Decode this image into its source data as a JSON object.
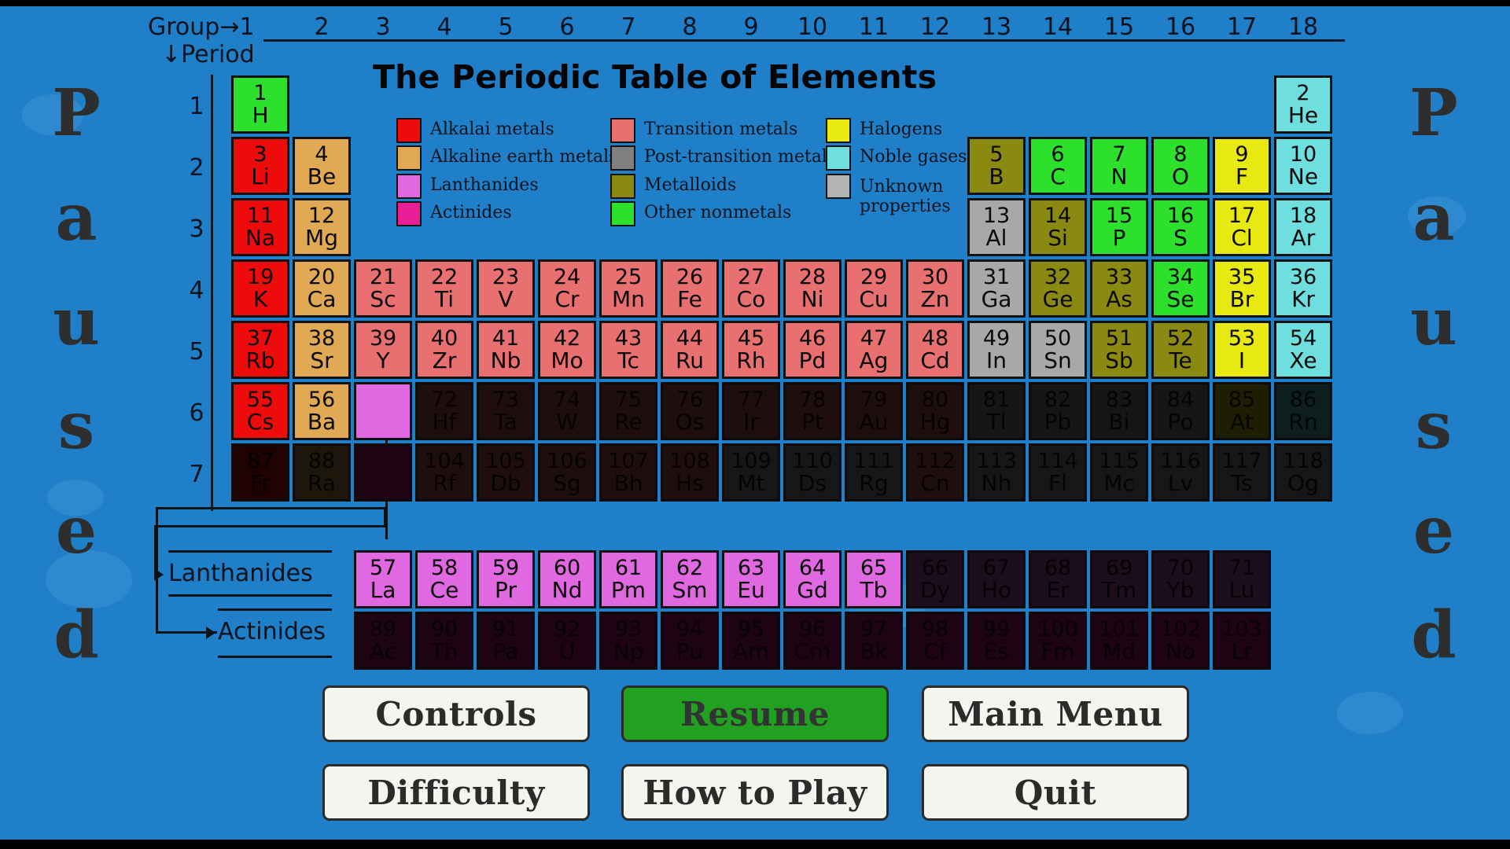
{
  "screen": {
    "background_color": "#1f7fc9",
    "paused_text": "Paused",
    "title": "The Periodic Table of Elements",
    "group_label": "Group→1",
    "period_label": "↓Period",
    "group_numbers": [
      "2",
      "3",
      "4",
      "5",
      "6",
      "7",
      "8",
      "9",
      "10",
      "11",
      "12",
      "13",
      "14",
      "15",
      "16",
      "17",
      "18"
    ],
    "period_numbers": [
      "1",
      "2",
      "3",
      "4",
      "5",
      "6",
      "7"
    ],
    "lanthanides_label": "Lanthanides",
    "actinides_label": "Actinides"
  },
  "legend": {
    "items": [
      {
        "label": "Alkalai metals",
        "color": "#ee0b0b"
      },
      {
        "label": "Alkaline earth metals",
        "color": "#e2a955"
      },
      {
        "label": "Lanthanides",
        "color": "#e068e0"
      },
      {
        "label": "Actinides",
        "color": "#e81e96"
      },
      {
        "label": "Transition metals",
        "color": "#e97070"
      },
      {
        "label": "Post-transition metals",
        "color": "#7f7f7f"
      },
      {
        "label": "Metalloids",
        "color": "#8a8a12"
      },
      {
        "label": "Other nonmetals",
        "color": "#2ce02c"
      },
      {
        "label": "Halogens",
        "color": "#e8e812"
      },
      {
        "label": "Noble gases",
        "color": "#6fdede"
      },
      {
        "label": "Unknown properties",
        "color": "#b3b3b3"
      }
    ]
  },
  "buttons": [
    {
      "label": "Controls",
      "style": "light"
    },
    {
      "label": "Resume",
      "style": "green"
    },
    {
      "label": "Main Menu",
      "style": "light"
    },
    {
      "label": "Difficulty",
      "style": "light"
    },
    {
      "label": "How to Play",
      "style": "light"
    },
    {
      "label": "Quit",
      "style": "light"
    }
  ],
  "elements": [
    {
      "n": 1,
      "s": "H",
      "g": 1,
      "p": 1,
      "c": "#2ce02c",
      "dim": false
    },
    {
      "n": 2,
      "s": "He",
      "g": 18,
      "p": 1,
      "c": "#6fdede",
      "dim": false
    },
    {
      "n": 3,
      "s": "Li",
      "g": 1,
      "p": 2,
      "c": "#ee0b0b",
      "dim": false
    },
    {
      "n": 4,
      "s": "Be",
      "g": 2,
      "p": 2,
      "c": "#e2a955",
      "dim": false
    },
    {
      "n": 5,
      "s": "B",
      "g": 13,
      "p": 2,
      "c": "#8a8a12",
      "dim": false
    },
    {
      "n": 6,
      "s": "C",
      "g": 14,
      "p": 2,
      "c": "#2ce02c",
      "dim": false
    },
    {
      "n": 7,
      "s": "N",
      "g": 15,
      "p": 2,
      "c": "#2ce02c",
      "dim": false
    },
    {
      "n": 8,
      "s": "O",
      "g": 16,
      "p": 2,
      "c": "#2ce02c",
      "dim": false
    },
    {
      "n": 9,
      "s": "F",
      "g": 17,
      "p": 2,
      "c": "#e8e812",
      "dim": false
    },
    {
      "n": 10,
      "s": "Ne",
      "g": 18,
      "p": 2,
      "c": "#6fdede",
      "dim": false
    },
    {
      "n": 11,
      "s": "Na",
      "g": 1,
      "p": 3,
      "c": "#ee0b0b",
      "dim": false
    },
    {
      "n": 12,
      "s": "Mg",
      "g": 2,
      "p": 3,
      "c": "#e2a955",
      "dim": false
    },
    {
      "n": 13,
      "s": "Al",
      "g": 13,
      "p": 3,
      "c": "#a8a8a8",
      "dim": false
    },
    {
      "n": 14,
      "s": "Si",
      "g": 14,
      "p": 3,
      "c": "#8a8a12",
      "dim": false
    },
    {
      "n": 15,
      "s": "P",
      "g": 15,
      "p": 3,
      "c": "#2ce02c",
      "dim": false
    },
    {
      "n": 16,
      "s": "S",
      "g": 16,
      "p": 3,
      "c": "#2ce02c",
      "dim": false
    },
    {
      "n": 17,
      "s": "Cl",
      "g": 17,
      "p": 3,
      "c": "#e8e812",
      "dim": false
    },
    {
      "n": 18,
      "s": "Ar",
      "g": 18,
      "p": 3,
      "c": "#6fdede",
      "dim": false
    },
    {
      "n": 19,
      "s": "K",
      "g": 1,
      "p": 4,
      "c": "#ee0b0b",
      "dim": false
    },
    {
      "n": 20,
      "s": "Ca",
      "g": 2,
      "p": 4,
      "c": "#e2a955",
      "dim": false
    },
    {
      "n": 21,
      "s": "Sc",
      "g": 3,
      "p": 4,
      "c": "#e97070",
      "dim": false
    },
    {
      "n": 22,
      "s": "Ti",
      "g": 4,
      "p": 4,
      "c": "#e97070",
      "dim": false
    },
    {
      "n": 23,
      "s": "V",
      "g": 5,
      "p": 4,
      "c": "#e97070",
      "dim": false
    },
    {
      "n": 24,
      "s": "Cr",
      "g": 6,
      "p": 4,
      "c": "#e97070",
      "dim": false
    },
    {
      "n": 25,
      "s": "Mn",
      "g": 7,
      "p": 4,
      "c": "#e97070",
      "dim": false
    },
    {
      "n": 26,
      "s": "Fe",
      "g": 8,
      "p": 4,
      "c": "#e97070",
      "dim": false
    },
    {
      "n": 27,
      "s": "Co",
      "g": 9,
      "p": 4,
      "c": "#e97070",
      "dim": false
    },
    {
      "n": 28,
      "s": "Ni",
      "g": 10,
      "p": 4,
      "c": "#e97070",
      "dim": false
    },
    {
      "n": 29,
      "s": "Cu",
      "g": 11,
      "p": 4,
      "c": "#e97070",
      "dim": false
    },
    {
      "n": 30,
      "s": "Zn",
      "g": 12,
      "p": 4,
      "c": "#e97070",
      "dim": false
    },
    {
      "n": 31,
      "s": "Ga",
      "g": 13,
      "p": 4,
      "c": "#a8a8a8",
      "dim": false
    },
    {
      "n": 32,
      "s": "Ge",
      "g": 14,
      "p": 4,
      "c": "#8a8a12",
      "dim": false
    },
    {
      "n": 33,
      "s": "As",
      "g": 15,
      "p": 4,
      "c": "#8a8a12",
      "dim": false
    },
    {
      "n": 34,
      "s": "Se",
      "g": 16,
      "p": 4,
      "c": "#2ce02c",
      "dim": false
    },
    {
      "n": 35,
      "s": "Br",
      "g": 17,
      "p": 4,
      "c": "#e8e812",
      "dim": false
    },
    {
      "n": 36,
      "s": "Kr",
      "g": 18,
      "p": 4,
      "c": "#6fdede",
      "dim": false
    },
    {
      "n": 37,
      "s": "Rb",
      "g": 1,
      "p": 5,
      "c": "#ee0b0b",
      "dim": false
    },
    {
      "n": 38,
      "s": "Sr",
      "g": 2,
      "p": 5,
      "c": "#e2a955",
      "dim": false
    },
    {
      "n": 39,
      "s": "Y",
      "g": 3,
      "p": 5,
      "c": "#e97070",
      "dim": false
    },
    {
      "n": 40,
      "s": "Zr",
      "g": 4,
      "p": 5,
      "c": "#e97070",
      "dim": false
    },
    {
      "n": 41,
      "s": "Nb",
      "g": 5,
      "p": 5,
      "c": "#e97070",
      "dim": false
    },
    {
      "n": 42,
      "s": "Mo",
      "g": 6,
      "p": 5,
      "c": "#e97070",
      "dim": false
    },
    {
      "n": 43,
      "s": "Tc",
      "g": 7,
      "p": 5,
      "c": "#e97070",
      "dim": false
    },
    {
      "n": 44,
      "s": "Ru",
      "g": 8,
      "p": 5,
      "c": "#e97070",
      "dim": false
    },
    {
      "n": 45,
      "s": "Rh",
      "g": 9,
      "p": 5,
      "c": "#e97070",
      "dim": false
    },
    {
      "n": 46,
      "s": "Pd",
      "g": 10,
      "p": 5,
      "c": "#e97070",
      "dim": false
    },
    {
      "n": 47,
      "s": "Ag",
      "g": 11,
      "p": 5,
      "c": "#e97070",
      "dim": false
    },
    {
      "n": 48,
      "s": "Cd",
      "g": 12,
      "p": 5,
      "c": "#e97070",
      "dim": false
    },
    {
      "n": 49,
      "s": "In",
      "g": 13,
      "p": 5,
      "c": "#a8a8a8",
      "dim": false
    },
    {
      "n": 50,
      "s": "Sn",
      "g": 14,
      "p": 5,
      "c": "#a8a8a8",
      "dim": false
    },
    {
      "n": 51,
      "s": "Sb",
      "g": 15,
      "p": 5,
      "c": "#8a8a12",
      "dim": false
    },
    {
      "n": 52,
      "s": "Te",
      "g": 16,
      "p": 5,
      "c": "#8a8a12",
      "dim": false
    },
    {
      "n": 53,
      "s": "I",
      "g": 17,
      "p": 5,
      "c": "#e8e812",
      "dim": false
    },
    {
      "n": 54,
      "s": "Xe",
      "g": 18,
      "p": 5,
      "c": "#6fdede",
      "dim": false
    },
    {
      "n": 55,
      "s": "Cs",
      "g": 1,
      "p": 6,
      "c": "#ee0b0b",
      "dim": false
    },
    {
      "n": 56,
      "s": "Ba",
      "g": 2,
      "p": 6,
      "c": "#e2a955",
      "dim": false
    },
    {
      "n": 0,
      "s": "",
      "g": 3,
      "p": 6,
      "c": "#e068e0",
      "dim": false,
      "blank": true
    },
    {
      "n": 72,
      "s": "Hf",
      "g": 4,
      "p": 6,
      "c": "#e97070",
      "dim": true
    },
    {
      "n": 73,
      "s": "Ta",
      "g": 5,
      "p": 6,
      "c": "#e97070",
      "dim": true
    },
    {
      "n": 74,
      "s": "W",
      "g": 6,
      "p": 6,
      "c": "#e97070",
      "dim": true
    },
    {
      "n": 75,
      "s": "Re",
      "g": 7,
      "p": 6,
      "c": "#e97070",
      "dim": true
    },
    {
      "n": 76,
      "s": "Os",
      "g": 8,
      "p": 6,
      "c": "#e97070",
      "dim": true
    },
    {
      "n": 77,
      "s": "Ir",
      "g": 9,
      "p": 6,
      "c": "#e97070",
      "dim": true
    },
    {
      "n": 78,
      "s": "Pt",
      "g": 10,
      "p": 6,
      "c": "#e97070",
      "dim": true
    },
    {
      "n": 79,
      "s": "Au",
      "g": 11,
      "p": 6,
      "c": "#e97070",
      "dim": true
    },
    {
      "n": 80,
      "s": "Hg",
      "g": 12,
      "p": 6,
      "c": "#e97070",
      "dim": true
    },
    {
      "n": 81,
      "s": "Tl",
      "g": 13,
      "p": 6,
      "c": "#a8a8a8",
      "dim": true
    },
    {
      "n": 82,
      "s": "Pb",
      "g": 14,
      "p": 6,
      "c": "#a8a8a8",
      "dim": true
    },
    {
      "n": 83,
      "s": "Bi",
      "g": 15,
      "p": 6,
      "c": "#a8a8a8",
      "dim": true
    },
    {
      "n": 84,
      "s": "Po",
      "g": 16,
      "p": 6,
      "c": "#a8a8a8",
      "dim": true
    },
    {
      "n": 85,
      "s": "At",
      "g": 17,
      "p": 6,
      "c": "#e8e812",
      "dim": true
    },
    {
      "n": 86,
      "s": "Rn",
      "g": 18,
      "p": 6,
      "c": "#6fdede",
      "dim": true
    },
    {
      "n": 87,
      "s": "Fr",
      "g": 1,
      "p": 7,
      "c": "#ee0b0b",
      "dim": true
    },
    {
      "n": 88,
      "s": "Ra",
      "g": 2,
      "p": 7,
      "c": "#e2a955",
      "dim": true
    },
    {
      "n": 0,
      "s": "",
      "g": 3,
      "p": 7,
      "c": "#e81e96",
      "dim": true,
      "blank": true
    },
    {
      "n": 104,
      "s": "Rf",
      "g": 4,
      "p": 7,
      "c": "#e97070",
      "dim": true
    },
    {
      "n": 105,
      "s": "Db",
      "g": 5,
      "p": 7,
      "c": "#e97070",
      "dim": true
    },
    {
      "n": 106,
      "s": "Sg",
      "g": 6,
      "p": 7,
      "c": "#e97070",
      "dim": true
    },
    {
      "n": 107,
      "s": "Bh",
      "g": 7,
      "p": 7,
      "c": "#e97070",
      "dim": true
    },
    {
      "n": 108,
      "s": "Hs",
      "g": 8,
      "p": 7,
      "c": "#e97070",
      "dim": true
    },
    {
      "n": 109,
      "s": "Mt",
      "g": 9,
      "p": 7,
      "c": "#b3b3b3",
      "dim": true
    },
    {
      "n": 110,
      "s": "Ds",
      "g": 10,
      "p": 7,
      "c": "#b3b3b3",
      "dim": true
    },
    {
      "n": 111,
      "s": "Rg",
      "g": 11,
      "p": 7,
      "c": "#b3b3b3",
      "dim": true
    },
    {
      "n": 112,
      "s": "Cn",
      "g": 12,
      "p": 7,
      "c": "#e97070",
      "dim": true
    },
    {
      "n": 113,
      "s": "Nh",
      "g": 13,
      "p": 7,
      "c": "#b3b3b3",
      "dim": true
    },
    {
      "n": 114,
      "s": "Fl",
      "g": 14,
      "p": 7,
      "c": "#b3b3b3",
      "dim": true
    },
    {
      "n": 115,
      "s": "Mc",
      "g": 15,
      "p": 7,
      "c": "#b3b3b3",
      "dim": true
    },
    {
      "n": 116,
      "s": "Lv",
      "g": 16,
      "p": 7,
      "c": "#b3b3b3",
      "dim": true
    },
    {
      "n": 117,
      "s": "Ts",
      "g": 17,
      "p": 7,
      "c": "#b3b3b3",
      "dim": true
    },
    {
      "n": 118,
      "s": "Og",
      "g": 18,
      "p": 7,
      "c": "#b3b3b3",
      "dim": true
    }
  ],
  "lanthanides": [
    {
      "n": 57,
      "s": "La",
      "c": "#e068e0",
      "dim": false
    },
    {
      "n": 58,
      "s": "Ce",
      "c": "#e068e0",
      "dim": false
    },
    {
      "n": 59,
      "s": "Pr",
      "c": "#e068e0",
      "dim": false
    },
    {
      "n": 60,
      "s": "Nd",
      "c": "#e068e0",
      "dim": false
    },
    {
      "n": 61,
      "s": "Pm",
      "c": "#e068e0",
      "dim": false
    },
    {
      "n": 62,
      "s": "Sm",
      "c": "#e068e0",
      "dim": false
    },
    {
      "n": 63,
      "s": "Eu",
      "c": "#e068e0",
      "dim": false
    },
    {
      "n": 64,
      "s": "Gd",
      "c": "#e068e0",
      "dim": false
    },
    {
      "n": 65,
      "s": "Tb",
      "c": "#e068e0",
      "dim": false
    },
    {
      "n": 66,
      "s": "Dy",
      "c": "#e068e0",
      "dim": true
    },
    {
      "n": 67,
      "s": "Ho",
      "c": "#e068e0",
      "dim": true
    },
    {
      "n": 68,
      "s": "Er",
      "c": "#e068e0",
      "dim": true
    },
    {
      "n": 69,
      "s": "Tm",
      "c": "#e068e0",
      "dim": true
    },
    {
      "n": 70,
      "s": "Yb",
      "c": "#e068e0",
      "dim": true
    },
    {
      "n": 71,
      "s": "Lu",
      "c": "#e068e0",
      "dim": true
    }
  ],
  "actinides": [
    {
      "n": 89,
      "s": "Ac",
      "c": "#e81e96",
      "dim": true
    },
    {
      "n": 90,
      "s": "Th",
      "c": "#e81e96",
      "dim": true
    },
    {
      "n": 91,
      "s": "Pa",
      "c": "#e81e96",
      "dim": true
    },
    {
      "n": 92,
      "s": "U",
      "c": "#e81e96",
      "dim": true
    },
    {
      "n": 93,
      "s": "Np",
      "c": "#e81e96",
      "dim": true
    },
    {
      "n": 94,
      "s": "Pu",
      "c": "#e81e96",
      "dim": true
    },
    {
      "n": 95,
      "s": "Am",
      "c": "#e81e96",
      "dim": true
    },
    {
      "n": 96,
      "s": "Cm",
      "c": "#e81e96",
      "dim": true
    },
    {
      "n": 97,
      "s": "Bk",
      "c": "#e81e96",
      "dim": true
    },
    {
      "n": 98,
      "s": "Cf",
      "c": "#e81e96",
      "dim": true
    },
    {
      "n": 99,
      "s": "Es",
      "c": "#e81e96",
      "dim": true
    },
    {
      "n": 100,
      "s": "Fm",
      "c": "#e81e96",
      "dim": true
    },
    {
      "n": 101,
      "s": "Md",
      "c": "#e81e96",
      "dim": true
    },
    {
      "n": 102,
      "s": "No",
      "c": "#e81e96",
      "dim": true
    },
    {
      "n": 103,
      "s": "Lr",
      "c": "#e81e96",
      "dim": true
    }
  ]
}
